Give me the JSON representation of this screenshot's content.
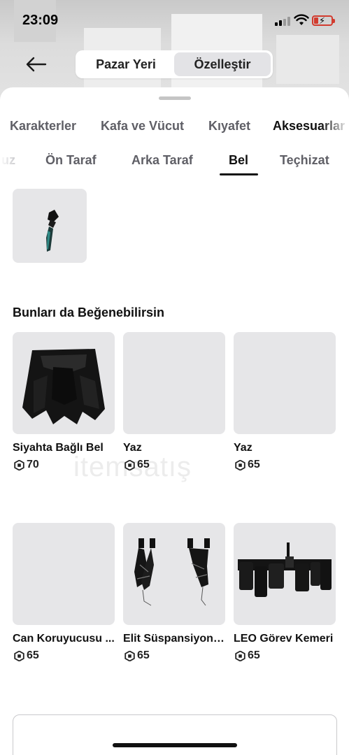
{
  "status_bar": {
    "time": "23:09"
  },
  "header": {
    "segments": [
      {
        "label": "Pazar Yeri",
        "active": false
      },
      {
        "label": "Özelleştir",
        "active": true
      }
    ]
  },
  "category_tabs": [
    {
      "label": "Karakterler",
      "active": false
    },
    {
      "label": "Kafa ve Vücut",
      "active": false
    },
    {
      "label": "Kıyafet",
      "active": false
    },
    {
      "label": "Aksesuarlar",
      "active": true
    }
  ],
  "sub_tabs": [
    {
      "label": "uz",
      "active": false
    },
    {
      "label": "Ön Taraf",
      "active": false
    },
    {
      "label": "Arka Taraf",
      "active": false
    },
    {
      "label": "Bel",
      "active": true
    },
    {
      "label": "Teçhizat",
      "active": false
    }
  ],
  "recommendations": {
    "title": "Bunları da Beğenebilirsin",
    "items": [
      {
        "name": "Siyahta Bağlı Bel",
        "price": "70",
        "thumb": "black-waist-wrap"
      },
      {
        "name": "Yaz",
        "price": "65",
        "thumb": "empty"
      },
      {
        "name": "Yaz",
        "price": "65",
        "thumb": "empty"
      },
      {
        "name": "Can Koruyucusu ...",
        "price": "65",
        "thumb": "empty"
      },
      {
        "name": "Elit Süspansiyonl...",
        "price": "65",
        "thumb": "suspenders"
      },
      {
        "name": "LEO Görev Kemeri",
        "price": "65",
        "thumb": "duty-belt"
      }
    ]
  },
  "watermark": "itemsatış",
  "colors": {
    "accent": "#111111",
    "tile": "#e6e6e8",
    "battery": "#d23b2e"
  }
}
